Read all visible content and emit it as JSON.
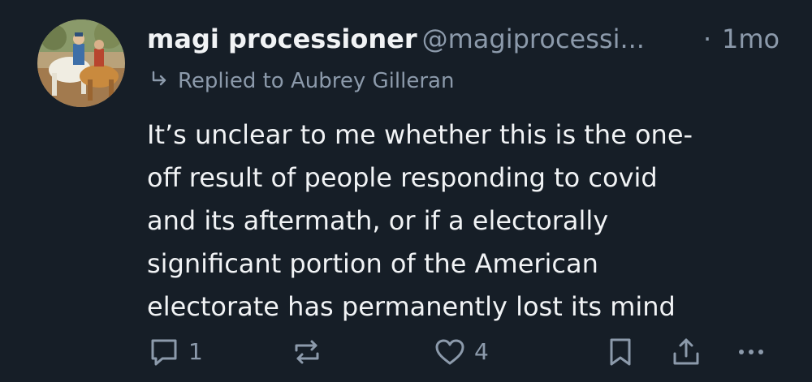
{
  "post": {
    "author_name": "magi processioner",
    "handle": "@magiprocessi...",
    "separator": "·",
    "time_ago": "1mo",
    "reply_to": "Replied to Aubrey Gilleran",
    "body_lines": [
      "It’s unclear to me whether this is the one-",
      "off result of people responding to covid",
      "and its aftermath, or if a electorally",
      "significant portion of the American",
      "electorate has permanently lost its mind"
    ]
  },
  "actions": {
    "reply_count": "1",
    "like_count": "4",
    "reply_icon": "speech-bubble-icon",
    "repost_icon": "repost-arrows-icon",
    "like_icon": "heart-icon",
    "bookmark_icon": "bookmark-icon",
    "share_icon": "share-upload-icon",
    "more_icon": "ellipsis-icon"
  },
  "colors": {
    "background": "#161e27",
    "text_primary": "#f1f3f5",
    "text_secondary": "#8c9aab"
  }
}
